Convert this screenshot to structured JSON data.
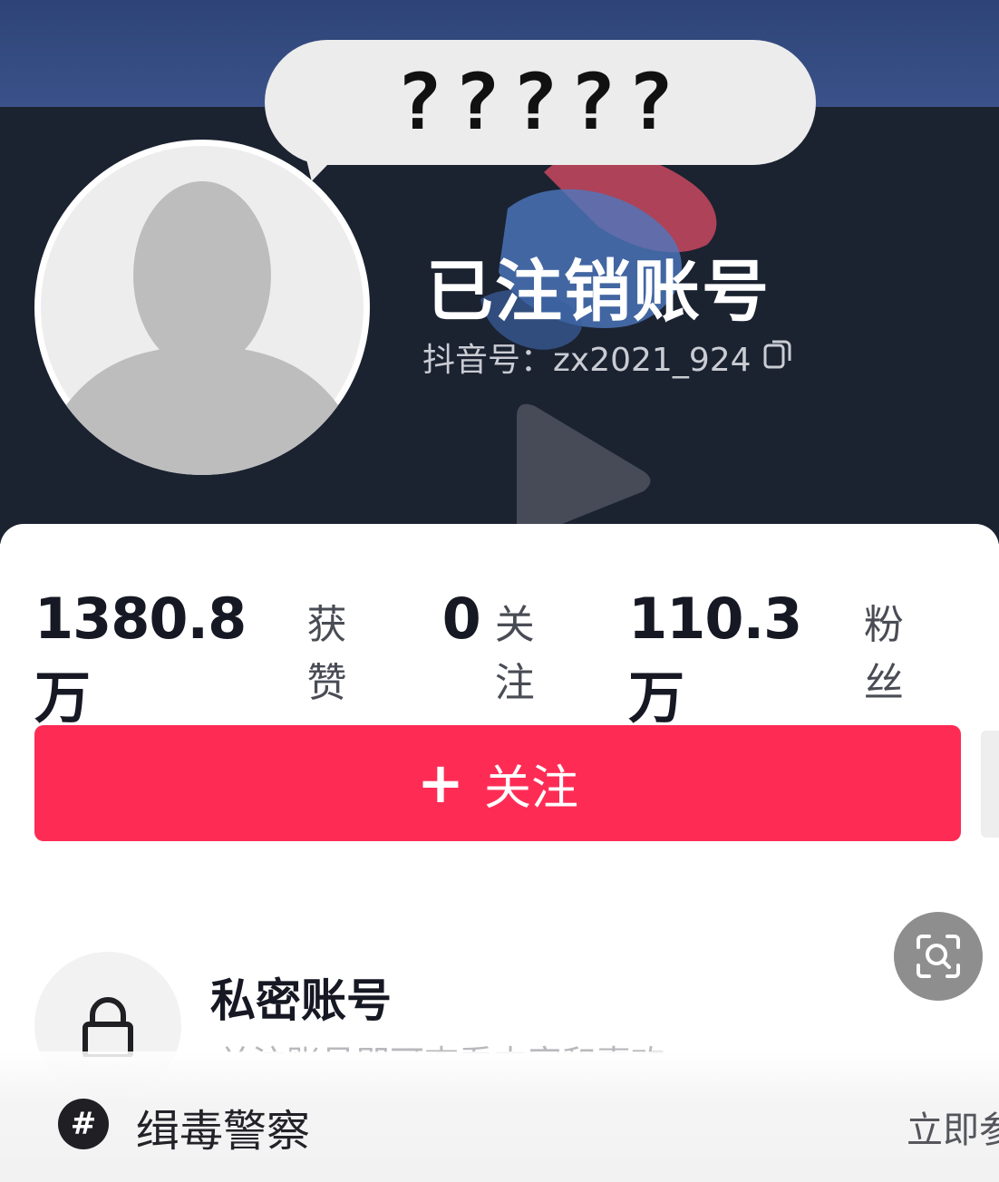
{
  "overlay": {
    "bubble_text": "?????"
  },
  "profile": {
    "name": "已注销账号",
    "douyin_id": "抖音号：zx2021_924"
  },
  "stats": [
    {
      "value": "1380.8万",
      "label": "获赞"
    },
    {
      "value": "0",
      "label": "关注"
    },
    {
      "value": "110.3万",
      "label": "粉丝"
    }
  ],
  "actions": {
    "follow_plus": "+",
    "follow_label": "关注"
  },
  "private_account": {
    "title": "私密账号",
    "description": "关注账号即可查看内容和喜欢"
  },
  "bottom_bar": {
    "topic": "缉毒警察",
    "action": "立即参"
  },
  "colors": {
    "accent": "#fe2c55",
    "header_bg": "#1b2230"
  }
}
